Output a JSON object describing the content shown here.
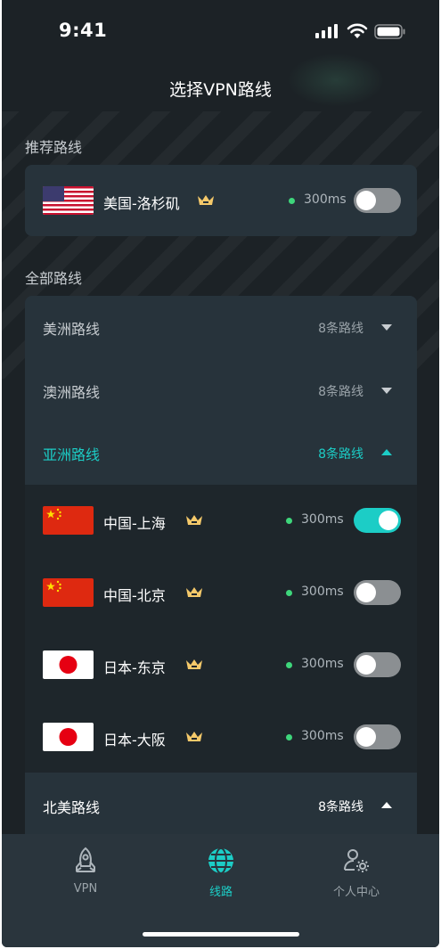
{
  "status_bar": {
    "time": "9:41"
  },
  "header": {
    "title": "选择VPN路线"
  },
  "recommended": {
    "label": "推荐路线",
    "item": {
      "name": "美国-洛杉矶",
      "flag": "usa-flag-icon",
      "latency": "300ms",
      "enabled": false
    }
  },
  "all_routes": {
    "label": "全部路线",
    "regions": [
      {
        "name": "美洲路线",
        "count": "8条路线",
        "expanded": false
      },
      {
        "name": "澳洲路线",
        "count": "8条路线",
        "expanded": false
      },
      {
        "name": "亚洲路线",
        "count": "8条路线",
        "expanded": true
      },
      {
        "name": "北美路线",
        "count": "8条路线",
        "expanded": true
      }
    ],
    "asia_items": [
      {
        "name": "中国-上海",
        "flag": "china-flag-icon",
        "latency": "300ms",
        "enabled": true
      },
      {
        "name": "中国-北京",
        "flag": "china-flag-icon",
        "latency": "300ms",
        "enabled": false
      },
      {
        "name": "日本-东京",
        "flag": "japan-flag-icon",
        "latency": "300ms",
        "enabled": false
      },
      {
        "name": "日本-大阪",
        "flag": "japan-flag-icon",
        "latency": "300ms",
        "enabled": false
      }
    ]
  },
  "tabbar": {
    "tabs": [
      {
        "label": "VPN",
        "icon": "rocket-icon",
        "active": false
      },
      {
        "label": "线路",
        "icon": "globe-icon",
        "active": true
      },
      {
        "label": "个人中心",
        "icon": "user-settings-icon",
        "active": false
      }
    ]
  },
  "colors": {
    "accent": "#1ccdc6",
    "background": "#1c2226",
    "card": "#27333b",
    "online": "#3ed67b",
    "crown": "#f5c96a"
  }
}
